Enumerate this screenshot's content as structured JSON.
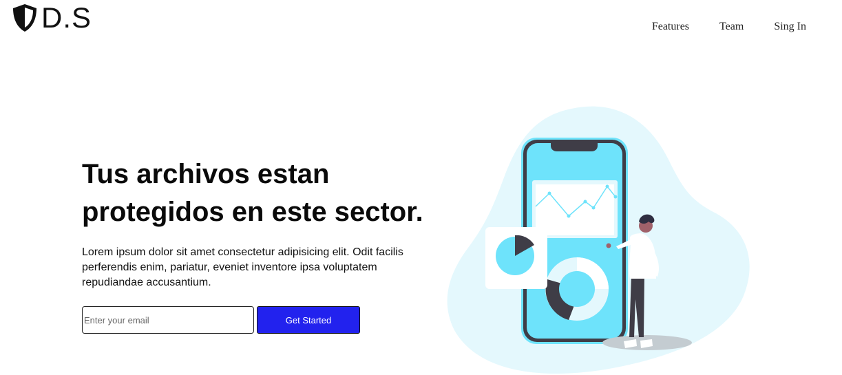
{
  "brand": {
    "name": "D.S",
    "icon": "shield-icon"
  },
  "nav": {
    "items": [
      "Features",
      "Team",
      "Sing In"
    ]
  },
  "hero": {
    "title": "Tus archivos estan protegidos en este sector.",
    "text": "Lorem ipsum dolor sit amet consectetur adipisicing elit. Odit facilis perferendis enim, pariatur, eveniet inventore ipsa voluptatem repudiandae accusantium."
  },
  "signup": {
    "email_placeholder": "Enter your email",
    "button_label": "Get Started"
  },
  "colors": {
    "accent": "#2222ee",
    "illustration_blue": "#6ee3fb",
    "blob": "#e4f8fd",
    "dark": "#3f3d47"
  }
}
